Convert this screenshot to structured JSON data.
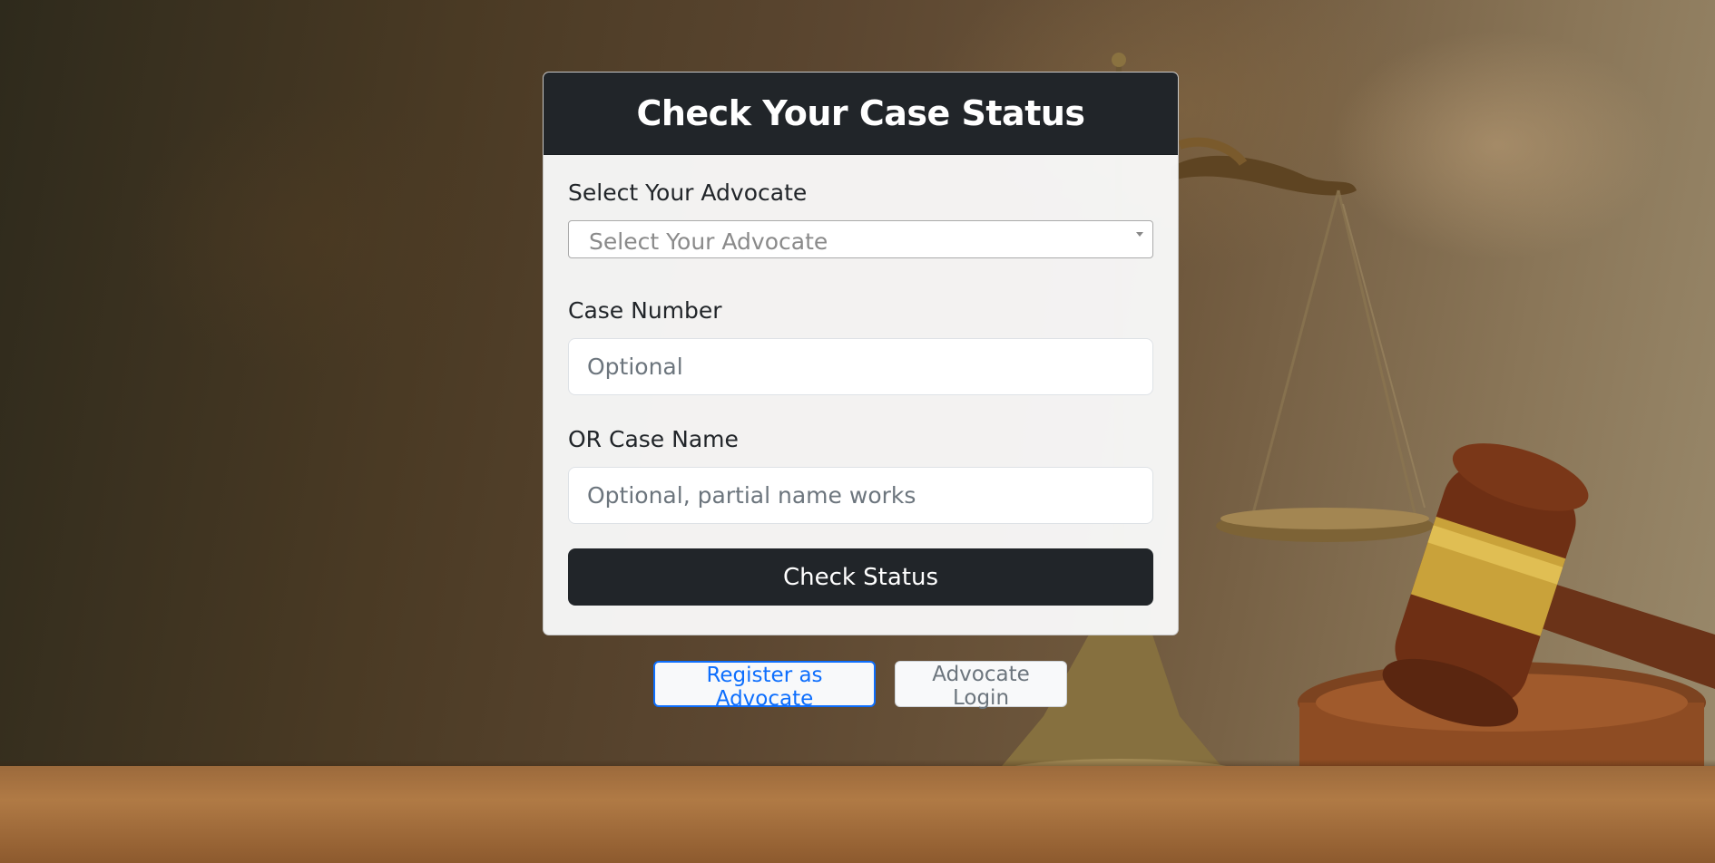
{
  "card": {
    "title": "Check Your Case Status"
  },
  "form": {
    "advocate_label": "Select Your Advocate",
    "advocate_select_value": "Select Your Advocate",
    "case_number_label": "Case Number",
    "case_number_placeholder": "Optional",
    "case_name_label": "OR Case Name",
    "case_name_placeholder": "Optional, partial name works",
    "submit_label": "Check Status"
  },
  "links": {
    "register_label": "Register as Advocate",
    "login_label": "Advocate Login"
  },
  "colors": {
    "header_bg": "#212529",
    "primary": "#0d6efd",
    "secondary": "#6c757d"
  },
  "icons": {
    "select_arrow": "caret-down-icon"
  }
}
